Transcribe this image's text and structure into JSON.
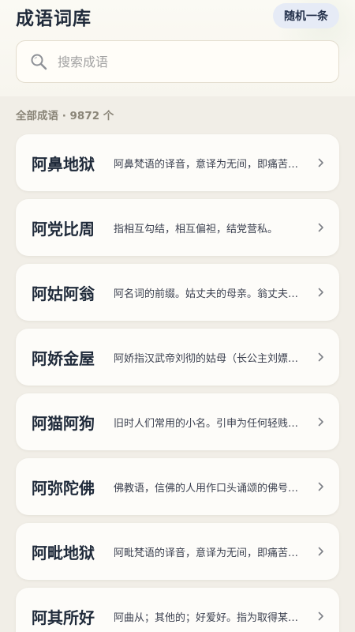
{
  "header": {
    "title": "成语词库",
    "random_button": "随机一条"
  },
  "search": {
    "placeholder": "搜索成语",
    "value": ""
  },
  "summary": {
    "text": "全部成语 · 9872 个"
  },
  "idioms": [
    {
      "word": "阿鼻地狱",
      "desc": "阿鼻梵语的译音，意译为无间，即痛苦无有间断之意。"
    },
    {
      "word": "阿党比周",
      "desc": "指相互勾结，相互偏袒，结党营私。"
    },
    {
      "word": "阿姑阿翁",
      "desc": "阿名词的前缀。姑丈夫的母亲。翁丈夫的父亲。"
    },
    {
      "word": "阿娇金屋",
      "desc": "阿娇指汉武帝刘彻的姑母（长公主刘嫖）的女儿。"
    },
    {
      "word": "阿猫阿狗",
      "desc": "旧时人们常用的小名。引申为任何轻贱的人或东西。"
    },
    {
      "word": "阿弥陀佛",
      "desc": "佛教语，信佛的人用作口头诵颂的佛号，表示祈祷。"
    },
    {
      "word": "阿毗地狱",
      "desc": "阿毗梵语的译音，意译为无间，即痛苦无有间断之意。"
    },
    {
      "word": "阿其所好",
      "desc": "阿曲从；其他的；好爱好。指为取得某人的欢心而迎合他的爱好。"
    }
  ],
  "colors": {
    "background": "#f1eee7",
    "card": "#fdfcf9",
    "title": "#1f2a3a",
    "button_bg": "#e6ebf6"
  },
  "icons": {
    "search": "search-icon",
    "chevron": "chevron-right-icon"
  }
}
